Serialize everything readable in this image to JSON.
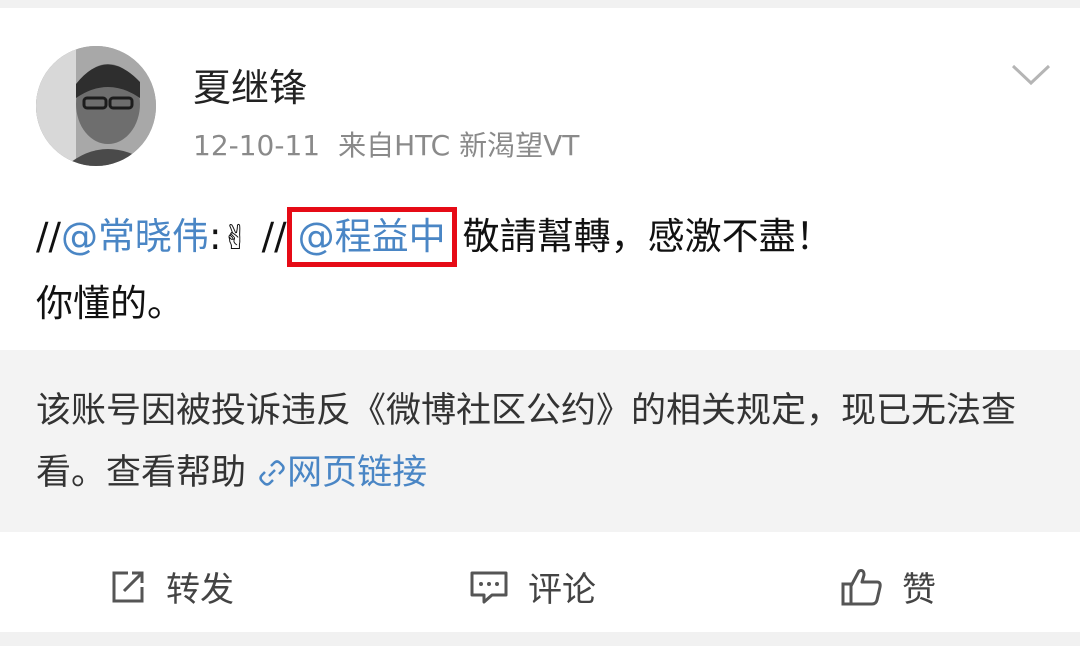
{
  "post": {
    "username": "夏继锋",
    "date": "12-10-11",
    "source": "来自HTC 新渴望VT",
    "body": {
      "slashes1": "//",
      "mention1": "@常晓伟",
      "colon": ":",
      "emoji": "✌",
      "slashes2": "//",
      "mention2": "@程益中",
      "text_line1_rest": "敬請幫轉，感激不盡！",
      "text_line2": "你懂的。"
    }
  },
  "notice": {
    "text": "该账号因被投诉违反《微博社区公约》的相关规定，现已无法查看。查看帮助",
    "link_label": "网页链接"
  },
  "actions": {
    "repost": "转发",
    "comment": "评论",
    "like": "赞"
  },
  "colors": {
    "mention": "#4a86c5",
    "highlight_border": "#e60b16"
  }
}
